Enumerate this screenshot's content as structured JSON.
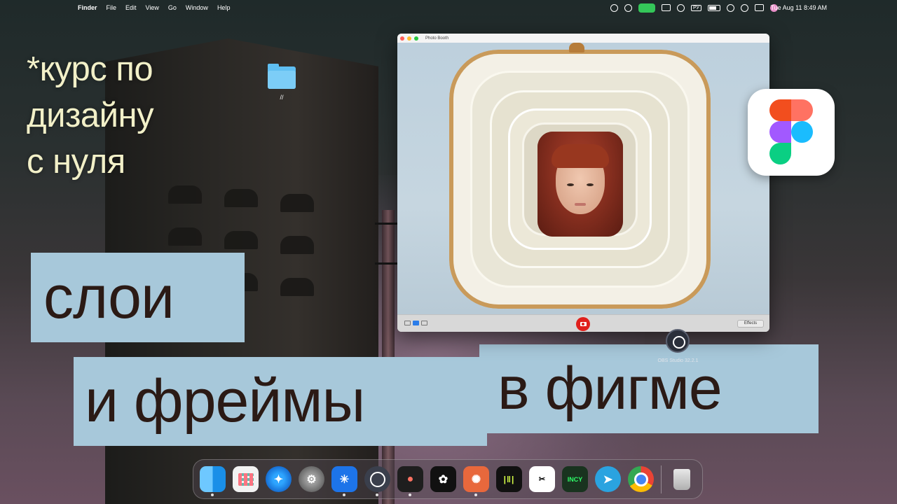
{
  "menubar": {
    "apple_glyph": "",
    "app_name": "Finder",
    "menus": [
      "File",
      "Edit",
      "View",
      "Go",
      "Window",
      "Help"
    ],
    "input_source": "РУ",
    "clock": "Tue Aug 11  8:49 AM"
  },
  "headline": {
    "subtitle_line1": "*курс по",
    "subtitle_line2": "дизайну",
    "subtitle_line3": "с нуля",
    "chip1": "слои",
    "chip2": "и фреймы",
    "chip3": "в фигме",
    "chip_color": "#a7c8da",
    "subtitle_color": "#f2f0c8"
  },
  "desktop": {
    "folder_label": "//",
    "obs_label": "OBS Studio 32.2.1"
  },
  "photobooth": {
    "title": "Photo Booth",
    "effects_label": "Effects"
  },
  "dock": {
    "items": [
      {
        "name": "finder-icon",
        "running": true
      },
      {
        "name": "launchpad-icon",
        "running": false
      },
      {
        "name": "safari-icon",
        "running": false
      },
      {
        "name": "system-settings-icon",
        "running": false
      },
      {
        "name": "perplexity-icon",
        "running": true
      },
      {
        "name": "obs-studio-icon",
        "running": true
      },
      {
        "name": "figma-icon",
        "running": true
      },
      {
        "name": "chatgpt-icon",
        "running": false
      },
      {
        "name": "claude-icon",
        "running": true
      },
      {
        "name": "audio-wave-icon",
        "running": false
      },
      {
        "name": "capcut-icon",
        "running": false
      },
      {
        "name": "incy-icon",
        "running": false
      },
      {
        "name": "telegram-icon",
        "running": false
      },
      {
        "name": "chrome-icon",
        "running": false
      },
      {
        "name": "trash-icon",
        "running": false
      }
    ],
    "incy_text": "INCY"
  }
}
